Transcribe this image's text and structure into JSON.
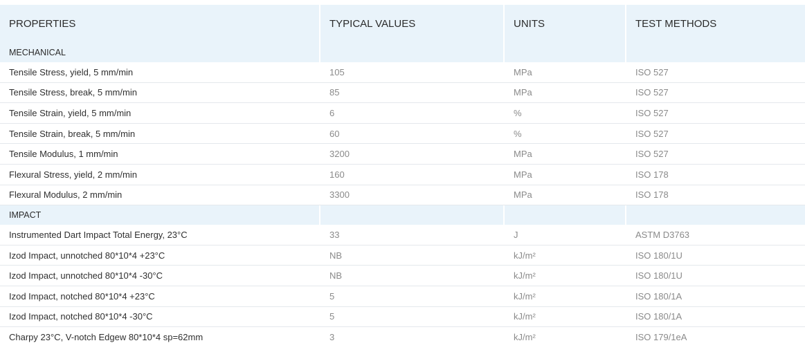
{
  "headers": {
    "properties": "PROPERTIES",
    "typical_values": "TYPICAL VALUES",
    "units": "UNITS",
    "test_methods": "TEST METHODS"
  },
  "sections": [
    {
      "title": "MECHANICAL",
      "rows": [
        {
          "property": "Tensile Stress, yield, 5 mm/min",
          "value": "105",
          "unit": "MPa",
          "method": "ISO 527"
        },
        {
          "property": "Tensile Stress, break, 5 mm/min",
          "value": "85",
          "unit": "MPa",
          "method": "ISO 527"
        },
        {
          "property": "Tensile Strain, yield, 5 mm/min",
          "value": "6",
          "unit": "%",
          "method": "ISO 527"
        },
        {
          "property": "Tensile Strain, break, 5 mm/min",
          "value": "60",
          "unit": "%",
          "method": "ISO 527"
        },
        {
          "property": "Tensile Modulus, 1 mm/min",
          "value": "3200",
          "unit": "MPa",
          "method": "ISO 527"
        },
        {
          "property": "Flexural Stress, yield, 2 mm/min",
          "value": "160",
          "unit": "MPa",
          "method": "ISO 178"
        },
        {
          "property": "Flexural Modulus, 2 mm/min",
          "value": "3300",
          "unit": "MPa",
          "method": "ISO 178"
        }
      ]
    },
    {
      "title": "IMPACT",
      "rows": [
        {
          "property": "Instrumented Dart Impact Total Energy, 23°C",
          "value": "33",
          "unit": "J",
          "method": "ASTM D3763"
        },
        {
          "property": "Izod Impact, unnotched 80*10*4 +23°C",
          "value": "NB",
          "unit": "kJ/m²",
          "method": "ISO 180/1U"
        },
        {
          "property": "Izod Impact, unnotched 80*10*4 -30°C",
          "value": "NB",
          "unit": "kJ/m²",
          "method": "ISO 180/1U"
        },
        {
          "property": "Izod Impact, notched 80*10*4 +23°C",
          "value": "5",
          "unit": "kJ/m²",
          "method": "ISO 180/1A"
        },
        {
          "property": "Izod Impact, notched 80*10*4 -30°C",
          "value": "5",
          "unit": "kJ/m²",
          "method": "ISO 180/1A"
        },
        {
          "property": "Charpy 23°C, V-notch Edgew 80*10*4 sp=62mm",
          "value": "3",
          "unit": "kJ/m²",
          "method": "ISO 179/1eA"
        }
      ]
    }
  ],
  "colors": {
    "header_bg": "#e9f3fa",
    "row_border": "#e4e8ec",
    "value_text": "#8a8a8a"
  }
}
